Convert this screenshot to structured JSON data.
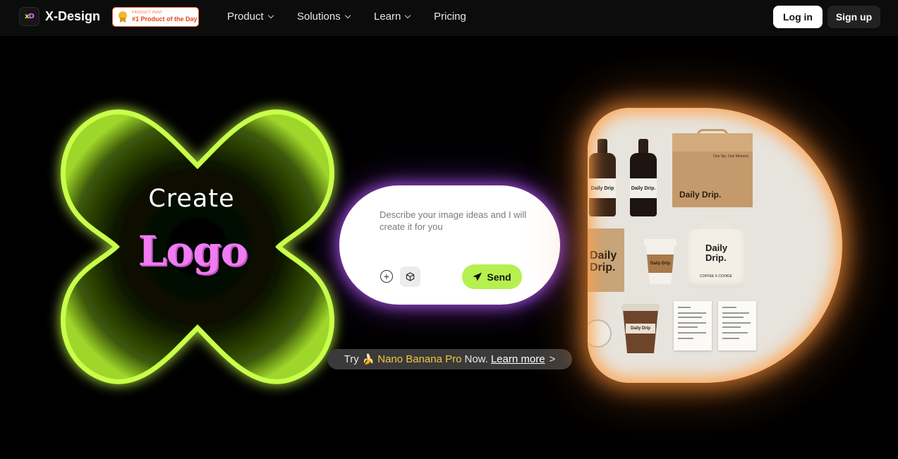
{
  "nav": {
    "brand": "X-Design",
    "brand_mark": {
      "x": "x",
      "d": "D"
    },
    "badge": {
      "small": "PRODUCT HUNT",
      "title": "#1 Product of the Day"
    },
    "menu": [
      {
        "label": "Product",
        "has_dropdown": true
      },
      {
        "label": "Solutions",
        "has_dropdown": true
      },
      {
        "label": "Learn",
        "has_dropdown": true
      },
      {
        "label": "Pricing",
        "has_dropdown": false
      }
    ],
    "login": "Log in",
    "signup": "Sign up"
  },
  "hero": {
    "line1": "Create",
    "line2": "Logo",
    "x_color": "#b8f53c",
    "word_color": "#f07bf2"
  },
  "prompt": {
    "placeholder": "Describe your image ideas and I will create it for you",
    "send": "Send",
    "add_icon": "plus-circle-icon",
    "model_icon": "cube-icon",
    "send_icon": "paper-plane-icon",
    "glow_color": "#ba5fff",
    "send_color": "#b6f04f"
  },
  "promo": {
    "prefix": "Try",
    "emoji": "🍌",
    "highlight": "Nano Banana Pro",
    "suffix": "Now.",
    "link": "Learn more",
    "arrow": ">"
  },
  "showcase": {
    "brand_text": "Daily Drip.",
    "brand_text_short": "Daily Drip",
    "box_tagline": "One Sip, One Moment.",
    "tote_sub": "COFFEE X COOKIE",
    "glow_color": "#ff9640"
  }
}
